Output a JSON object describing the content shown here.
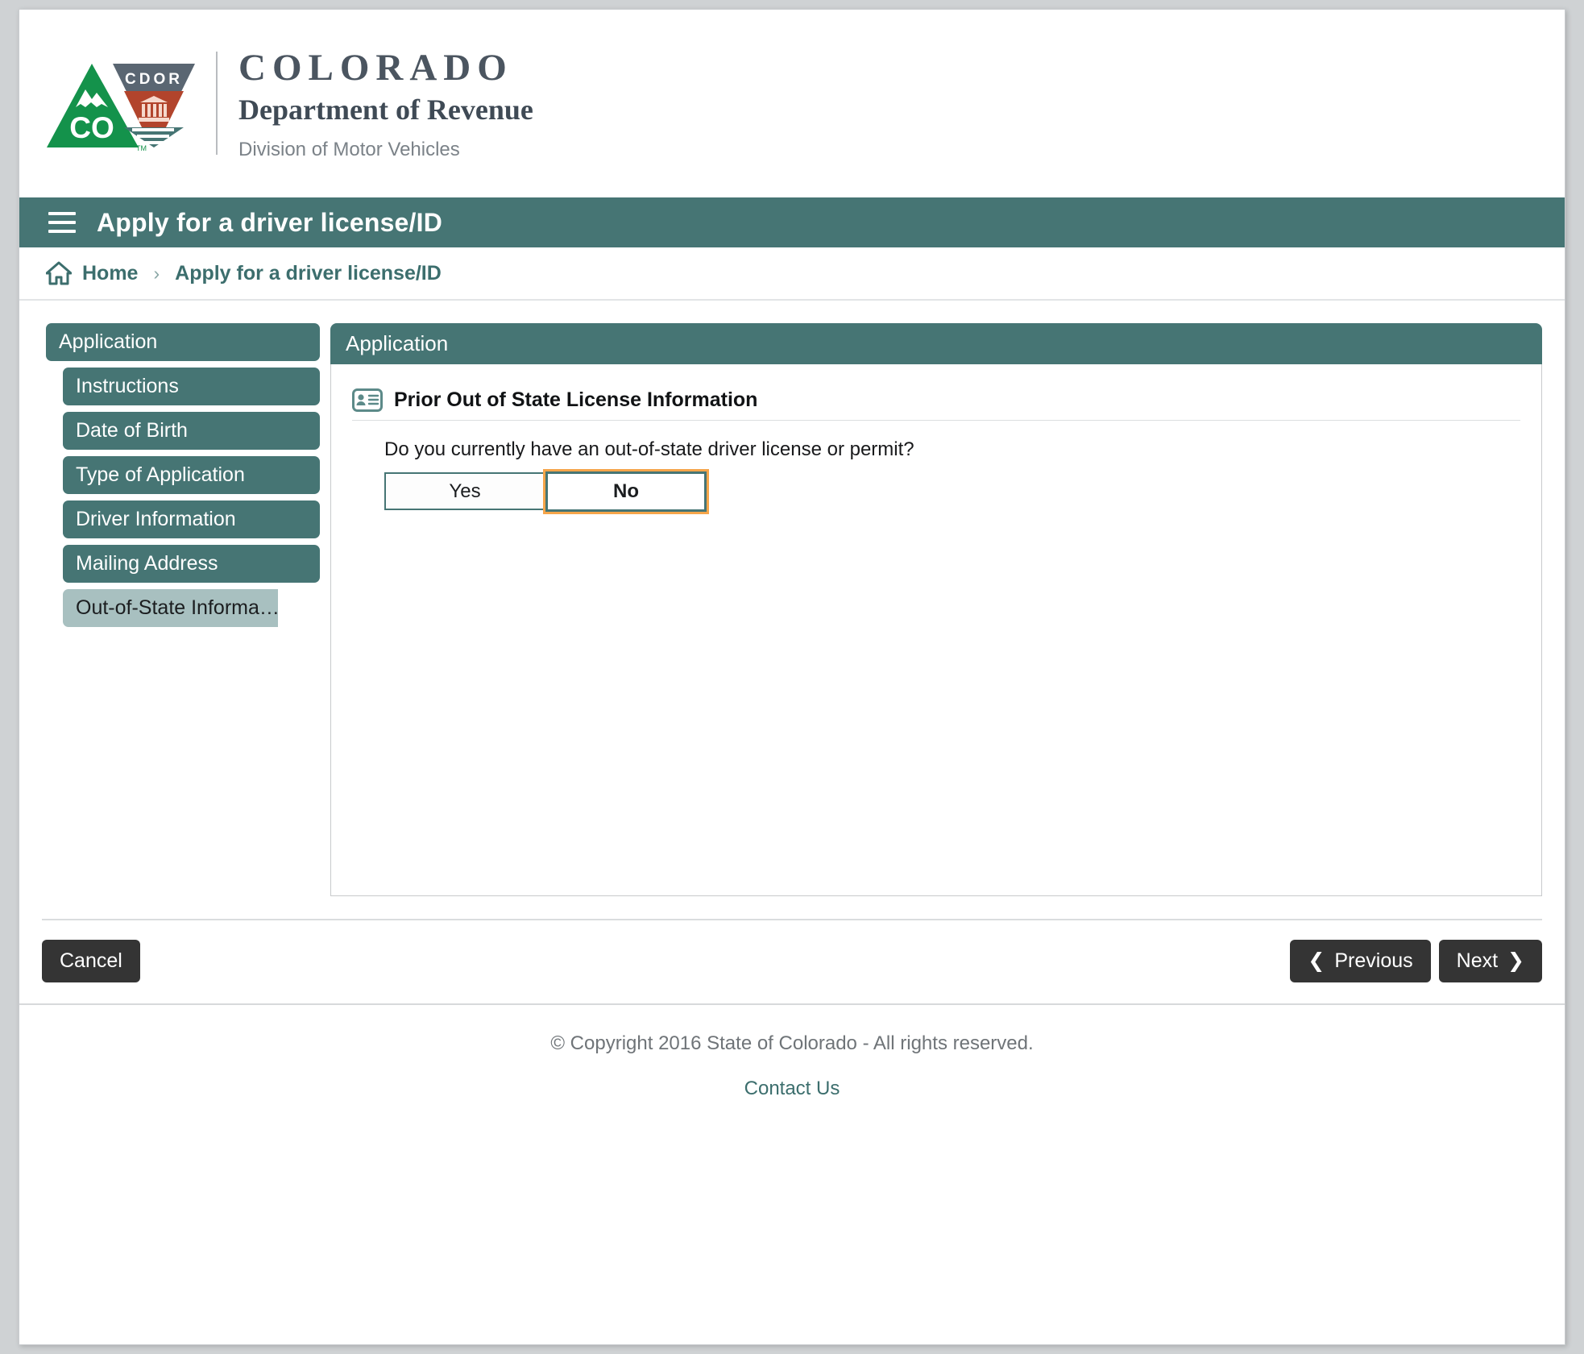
{
  "brand": {
    "colorado": "COLORADO",
    "department": "Department of Revenue",
    "division": "Division of Motor Vehicles",
    "logo_badge_text": "CDOR",
    "logo_state_abbrev": "CO",
    "logo_tm": "TM",
    "colors": {
      "teal": "#467574",
      "teal_light": "#a8c0c0",
      "green": "#14924b",
      "slate": "#5a6672",
      "rust": "#b2442c",
      "dark_button": "#343434",
      "focus_orange": "#f5a54a",
      "link": "#3c6e6d"
    }
  },
  "titlebar": {
    "menu_icon": "hamburger-icon",
    "title": "Apply for a driver license/ID"
  },
  "breadcrumb": {
    "home_icon": "home-icon",
    "home_label": "Home",
    "separator": "›",
    "current": "Apply for a driver license/ID"
  },
  "sidebar": {
    "group_label": "Application",
    "items": [
      {
        "label": "Instructions",
        "active": false
      },
      {
        "label": "Date of Birth",
        "active": false
      },
      {
        "label": "Type of Application",
        "active": false
      },
      {
        "label": "Driver Information",
        "active": false
      },
      {
        "label": "Mailing Address",
        "active": false
      },
      {
        "label": "Out-of-State Informa…",
        "active": true
      }
    ]
  },
  "panel": {
    "header": "Application",
    "section_icon": "id-card-icon",
    "section_title": "Prior Out of State License Information",
    "question": "Do you currently have an out-of-state driver license or permit?",
    "choices": [
      {
        "label": "Yes",
        "focused": false
      },
      {
        "label": "No",
        "focused": true
      }
    ]
  },
  "actions": {
    "cancel": "Cancel",
    "previous": "Previous",
    "next": "Next",
    "previous_icon": "chevron-left-icon",
    "next_icon": "chevron-right-icon"
  },
  "footer": {
    "copyright": "© Copyright 2016 State of Colorado - All rights reserved.",
    "contact": "Contact Us"
  }
}
